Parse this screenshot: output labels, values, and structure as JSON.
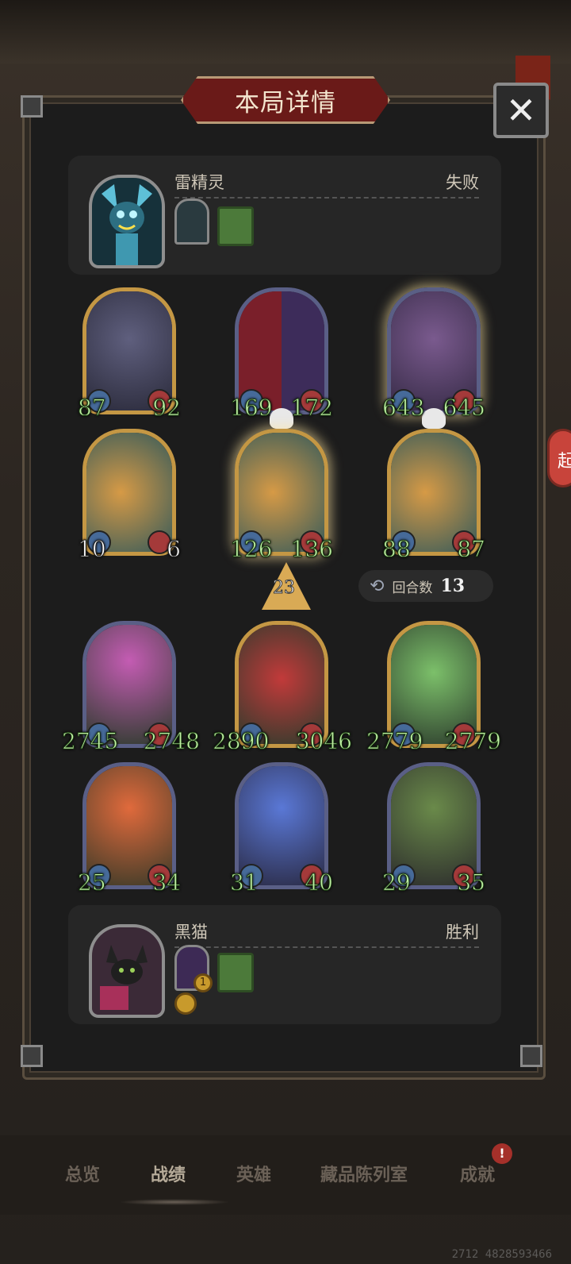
{
  "header": {
    "title": "本局详情",
    "close_icon": "close-icon"
  },
  "opponent": {
    "name": "雷精灵",
    "result": "失败"
  },
  "enemy_board": [
    {
      "atk": "87",
      "hp": "92"
    },
    {
      "atk": "169",
      "hp": "172"
    },
    {
      "atk": "643",
      "hp": "645"
    },
    {
      "atk": "10",
      "hp": "6"
    },
    {
      "atk": "126",
      "hp": "136"
    },
    {
      "atk": "88",
      "hp": "87"
    }
  ],
  "round_marker": "23",
  "turn_count": {
    "label": "回合数",
    "value": "13"
  },
  "player_board": [
    {
      "atk": "2745",
      "hp": "2748"
    },
    {
      "atk": "2890",
      "hp": "3046"
    },
    {
      "atk": "2779",
      "hp": "2779"
    },
    {
      "atk": "25",
      "hp": "34"
    },
    {
      "atk": "31",
      "hp": "40"
    },
    {
      "atk": "29",
      "hp": "35"
    }
  ],
  "player": {
    "name": "黑猫",
    "result": "胜利",
    "item_badge": "1"
  },
  "nav": {
    "tabs": [
      "总览",
      "战绩",
      "英雄",
      "藏品陈列室",
      "成就"
    ],
    "active": "战绩",
    "alert": "!"
  },
  "side_badge": "起",
  "footer_id": "2712 4828593466",
  "colors": {
    "stat_green": "#bff0a4",
    "gold_frame": "#c49744",
    "blue_frame": "#5a5f86",
    "title_red": "#6a1a18"
  }
}
